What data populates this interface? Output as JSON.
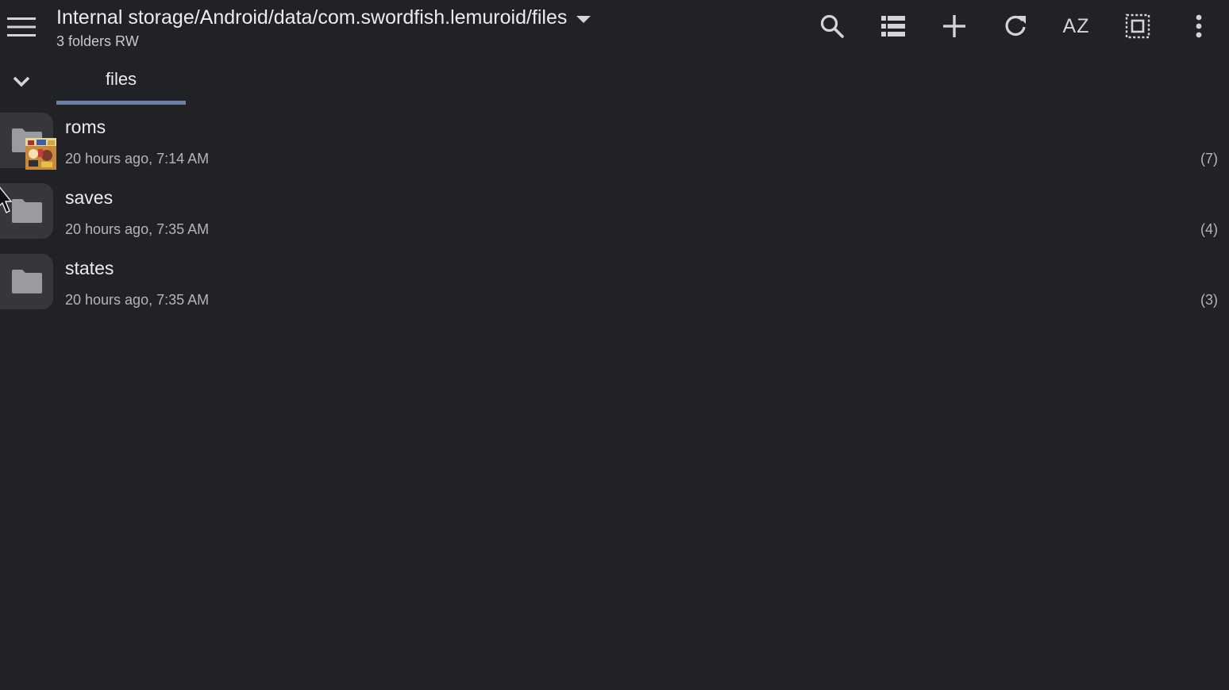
{
  "header": {
    "path": "Internal storage/Android/data/com.swordfish.lemuroid/files",
    "subtitle": "3 folders RW",
    "actions": [
      {
        "name": "search-icon"
      },
      {
        "name": "list-view-icon"
      },
      {
        "name": "add-icon"
      },
      {
        "name": "refresh-icon"
      },
      {
        "name": "sort-az-icon",
        "label": "AZ"
      },
      {
        "name": "select-all-icon"
      },
      {
        "name": "more-vert-icon"
      }
    ]
  },
  "tabs": [
    {
      "label": "files",
      "active": true
    }
  ],
  "items": [
    {
      "name": "roms",
      "date": "20 hours ago, 7:14 AM",
      "count": "(7)",
      "icon": "folder-icon"
    },
    {
      "name": "saves",
      "date": "20 hours ago, 7:35 AM",
      "count": "(4)",
      "icon": "folder-icon"
    },
    {
      "name": "states",
      "date": "20 hours ago, 7:35 AM",
      "count": "(3)",
      "icon": "folder-icon"
    }
  ],
  "colors": {
    "background": "#212226",
    "thumb_bg": "#36373c",
    "accent": "#6c7fa6",
    "text_primary": "#ececee",
    "text_secondary": "#b4b5b9"
  }
}
